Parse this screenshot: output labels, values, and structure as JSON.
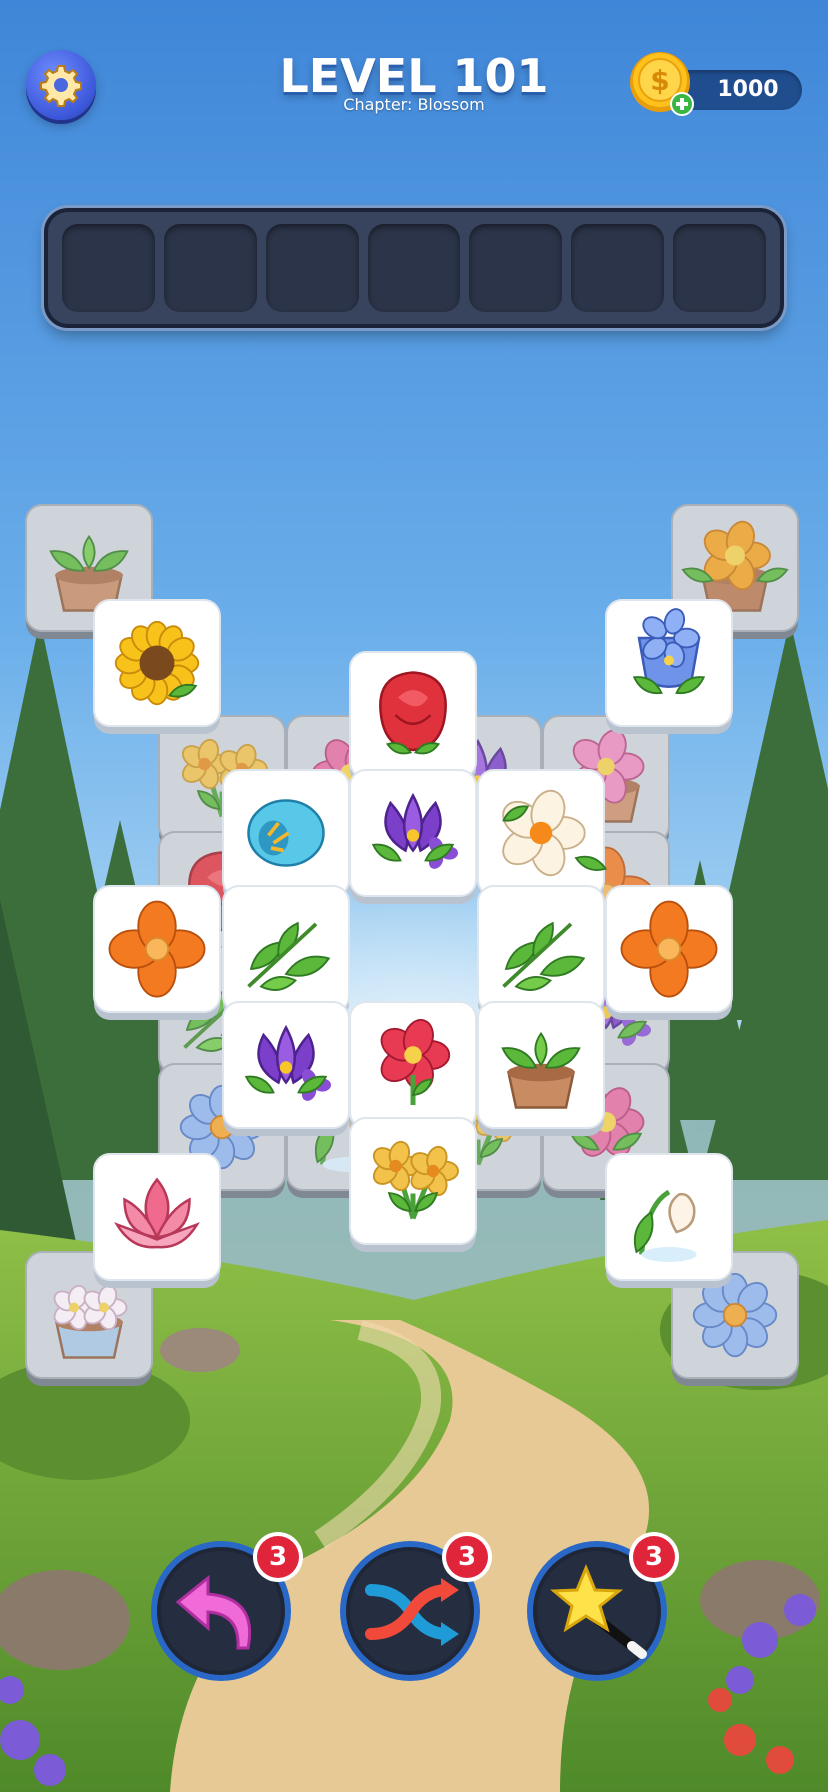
{
  "header": {
    "level_title": "LEVEL 101",
    "chapter": "Chapter: Blossom",
    "coins": "1000",
    "settings_icon": "gear-icon",
    "coin_icon": "dollar-coin-icon",
    "add_coins_icon": "plus-icon"
  },
  "tray": {
    "slot_count": 7
  },
  "boosters": [
    {
      "name": "undo",
      "icon": "undo-arrow-icon",
      "count": "3"
    },
    {
      "name": "shuffle",
      "icon": "shuffle-icon",
      "count": "3"
    },
    {
      "name": "magic",
      "icon": "magic-wand-icon",
      "count": "3"
    }
  ],
  "tiles": [
    {
      "icon": "potted-sprout",
      "layer": "bottom"
    },
    {
      "icon": "potted-orange-flower",
      "layer": "bottom"
    },
    {
      "icon": "yellow-daffodils",
      "layer": "bottom"
    },
    {
      "icon": "pink-flowers",
      "layer": "bottom"
    },
    {
      "icon": "purple-crocus",
      "layer": "bottom"
    },
    {
      "icon": "pink-flower-pot",
      "layer": "bottom"
    },
    {
      "icon": "red-rose",
      "layer": "bottom"
    },
    {
      "icon": "orange-lily",
      "layer": "bottom"
    },
    {
      "icon": "green-leaves",
      "layer": "bottom"
    },
    {
      "icon": "purple-crocus",
      "layer": "bottom"
    },
    {
      "icon": "blue-daisy",
      "layer": "bottom"
    },
    {
      "icon": "white-bulb",
      "layer": "bottom"
    },
    {
      "icon": "yellow-daffodils",
      "layer": "bottom"
    },
    {
      "icon": "pink-lily",
      "layer": "bottom"
    },
    {
      "icon": "white-flower-pot",
      "layer": "bottom"
    },
    {
      "icon": "blue-daisy",
      "layer": "bottom"
    },
    {
      "icon": "sunflower",
      "layer": "top"
    },
    {
      "icon": "blue-bellflower",
      "layer": "top"
    },
    {
      "icon": "red-rose",
      "layer": "top"
    },
    {
      "icon": "blue-bud",
      "layer": "top"
    },
    {
      "icon": "purple-crocus",
      "layer": "top"
    },
    {
      "icon": "white-flower",
      "layer": "top"
    },
    {
      "icon": "orange-flower",
      "layer": "top"
    },
    {
      "icon": "green-leaves",
      "layer": "top"
    },
    {
      "icon": "green-leaves",
      "layer": "top"
    },
    {
      "icon": "orange-flower",
      "layer": "top"
    },
    {
      "icon": "purple-crocus",
      "layer": "top"
    },
    {
      "icon": "red-poppy",
      "layer": "top"
    },
    {
      "icon": "potted-sprout",
      "layer": "top"
    },
    {
      "icon": "yellow-daffodils",
      "layer": "top"
    },
    {
      "icon": "pink-lotus",
      "layer": "top"
    },
    {
      "icon": "white-bulb",
      "layer": "top"
    }
  ],
  "colors": {
    "sky_top": "#3f86d8",
    "tray": "#38445e",
    "badge": "#e0243a",
    "coin": "#ffc21c"
  }
}
